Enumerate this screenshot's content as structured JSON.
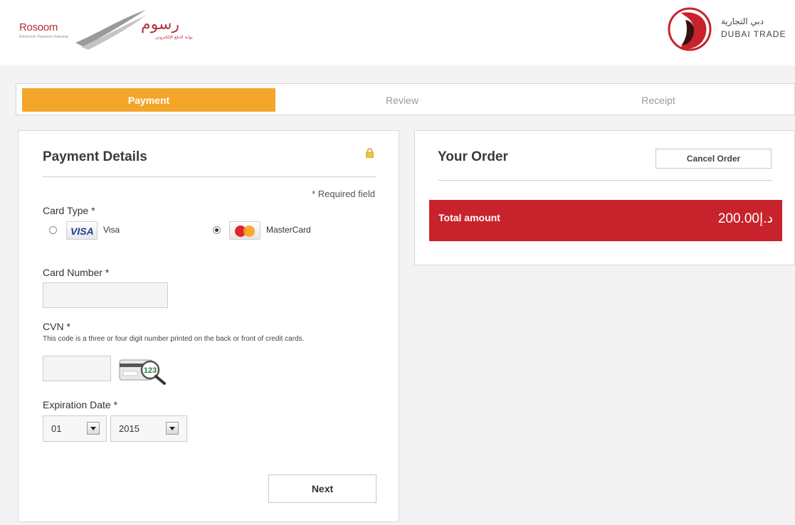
{
  "header": {
    "rosoom_name_en": "Rosoom",
    "rosoom_tagline_en": "Electronic Payment Gateway",
    "rosoom_name_ar": "رسوم",
    "rosoom_tagline_ar": "بوابة الدفع الإلكتروني",
    "dubai_trade_ar": "دبي التجارية",
    "dubai_trade_en": "DUBAI TRADE"
  },
  "steps": [
    {
      "label": "Payment",
      "active": true
    },
    {
      "label": "Review",
      "active": false
    },
    {
      "label": "Receipt",
      "active": false
    }
  ],
  "payment": {
    "title": "Payment Details",
    "required_note": "* Required field",
    "card_type_label": "Card Type *",
    "visa_badge": "VISA",
    "visa_label": "Visa",
    "mastercard_label": "MasterCard",
    "selected_card": "MasterCard",
    "card_number_label": "Card Number *",
    "card_number_value": "",
    "cvn_label": "CVN *",
    "cvn_help": "This code is a three or four digit number printed on the back or front of credit cards.",
    "cvn_value": "",
    "cvn_sample_digits": "123",
    "expiration_label": "Expiration Date *",
    "exp_month": "01",
    "exp_year": "2015",
    "next_label": "Next"
  },
  "order": {
    "title": "Your Order",
    "cancel_label": "Cancel Order",
    "total_label": "Total amount",
    "total_value": "د.إ200.00"
  },
  "colors": {
    "accent_orange": "#f4a62a",
    "total_red": "#c8232c",
    "brand_red": "#b5303a"
  },
  "icons": [
    "lock-icon",
    "visa-logo-icon",
    "mastercard-logo-icon",
    "cvn-card-magnifier-icon",
    "select-arrow-icon"
  ]
}
